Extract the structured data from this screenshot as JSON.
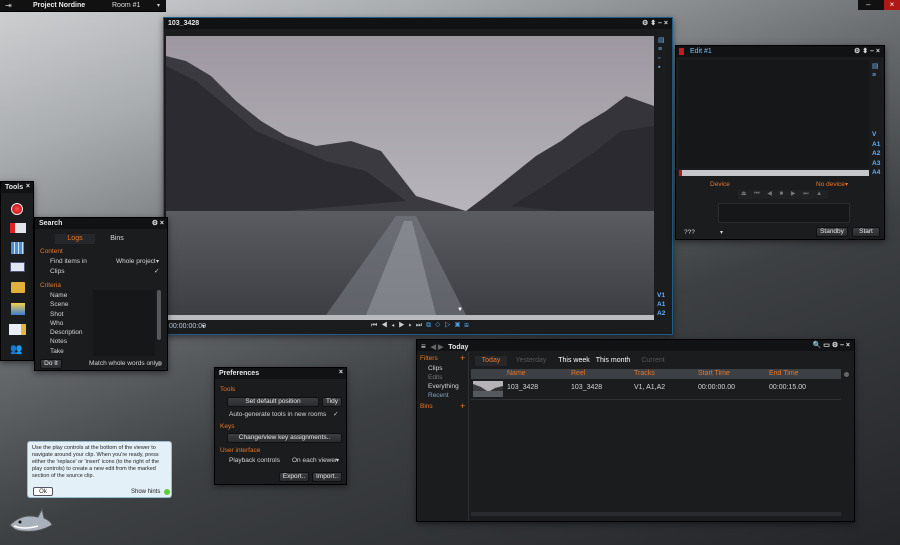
{
  "topbar": {
    "project": "Project Nordine",
    "room": "Room #1"
  },
  "viewer": {
    "title": "103_3428",
    "timecode": "00:00:00:00",
    "tracks": [
      "V1",
      "A1",
      "A2"
    ]
  },
  "edit": {
    "title": "Edit #1",
    "tracks": [
      "V",
      "A1",
      "A2",
      "A3",
      "A4"
    ],
    "device_label": "Device",
    "device_value": "No device",
    "mode": "???",
    "standby": "Standby",
    "start": "Start"
  },
  "tools": {
    "title": "Tools"
  },
  "search": {
    "title": "Search",
    "tabs": [
      "Logs",
      "Bins"
    ],
    "content_header": "Content",
    "find_label": "Find items in",
    "find_value": "Whole project",
    "clips_label": "Clips",
    "criteria_header": "Criteria",
    "criteria": [
      "Name",
      "Scene",
      "Shot",
      "Who",
      "Description",
      "Notes",
      "Take"
    ],
    "do_it": "Do It",
    "match_label": "Match whole words only"
  },
  "preferences": {
    "title": "Preferences",
    "tools_header": "Tools",
    "set_default": "Set default position",
    "tidy": "Tidy",
    "autogen": "Auto-generate tools in new rooms",
    "keys_header": "Keys",
    "change_keys": "Change/view key assignments..",
    "ui_header": "User interface",
    "playback_label": "Playback controls",
    "playback_value": "On each viewer",
    "export": "Export..",
    "import": "Import.."
  },
  "hint": {
    "text": "Use the play controls at the bottom of the viewer to navigate around your clip.  When you're ready, press either the 'replace' or 'insert' icons (to the right of the play controls) to create a new edit from the marked section of the source clip.",
    "ok": "Ok",
    "show_hints": "Show hints"
  },
  "browser": {
    "title": "Today",
    "filters_header": "Filters",
    "filters": [
      "Clips",
      "Edits",
      "Everything",
      "Recent"
    ],
    "bins_header": "Bins",
    "tabs": [
      "Today",
      "Yesterday",
      "This week",
      "This month",
      "Current"
    ],
    "columns": [
      "Name",
      "Reel",
      "Tracks",
      "Start Time",
      "End Time"
    ],
    "rows": [
      {
        "name": "103_3428",
        "reel": "103_3428",
        "tracks": "V1, A1,A2",
        "start": "00:00:00.00",
        "end": "00:00:15.00"
      }
    ]
  }
}
